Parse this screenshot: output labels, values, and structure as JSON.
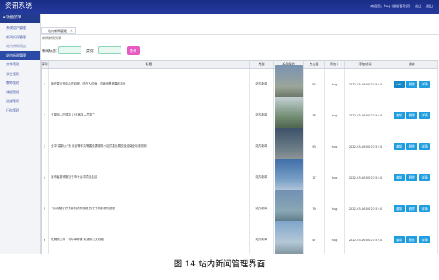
{
  "app": {
    "title": "资讯系统",
    "top_right": [
      "欢迎您，hug (超级管理员)",
      "退出",
      "退出"
    ]
  },
  "sidebar": {
    "header": "功能菜单",
    "items": [
      {
        "label": "系统用户管理",
        "active": false,
        "muted": false
      },
      {
        "label": "新闻新闻管理",
        "active": false,
        "muted": false
      },
      {
        "label": "站内新闻添加",
        "active": false,
        "muted": true
      },
      {
        "label": "站内新闻管理",
        "active": true,
        "muted": false
      },
      {
        "label": "文件管理",
        "active": false,
        "muted": false
      },
      {
        "label": "学生管理",
        "active": false,
        "muted": false
      },
      {
        "label": "教师管理",
        "active": false,
        "muted": false
      },
      {
        "label": "课程管理",
        "active": false,
        "muted": false
      },
      {
        "label": "选课管理",
        "active": false,
        "muted": false
      },
      {
        "label": "日志管理",
        "active": false,
        "muted": false
      }
    ]
  },
  "tab": {
    "label": "站内新闻管理",
    "close": "×"
  },
  "breadcrumb": "新闻新闻列表",
  "search": {
    "title_label": "新闻标题：",
    "type_label": "类别：",
    "button": "查询"
  },
  "table": {
    "headers": [
      "序号",
      "标题",
      "类别",
      "新闻图片",
      "点击量",
      "添加人",
      "添加时间",
      "操作"
    ],
    "actions": [
      "Edit",
      "删除",
      "详情"
    ],
    "actions_rest": [
      "编辑",
      "删除",
      "详情"
    ],
    "rows": [
      {
        "index": "1",
        "title": "她在重庆开启小院欢度，吃在人们身，同遍用着健康走市步",
        "category": "站内新闻",
        "views": "82",
        "adder": "hug",
        "time": "2022-03-16 00:23:52.0",
        "img": [
          "#7a93b0",
          "#9aa59a",
          "#4d5a44"
        ]
      },
      {
        "index": "2",
        "title": "五星组—四强攻入分  客队人员变亡",
        "category": "站内新闻",
        "views": "38",
        "adder": "hug",
        "time": "2022-03-16 00:23:52.0",
        "img": [
          "#c5d2d8",
          "#708a6f",
          "#384b3a"
        ]
      },
      {
        "index": "3",
        "title": "全中\"高新大\"首  设区等车站等建设要服务小区式推设展设保全保全标准测测",
        "category": "站内新闻",
        "views": "93",
        "adder": "hug",
        "time": "2022-03-16 00:23:52.0",
        "img": [
          "#3c5068",
          "#6b7c86",
          "#a4a8a5"
        ]
      },
      {
        "index": "4",
        "title": "我市省看得服目于市十会中项目会议",
        "category": "站内新闻",
        "views": "17",
        "adder": "hug",
        "time": "2022-03-16 00:23:52.0",
        "img": [
          "#3f6ea8",
          "#79a0c7",
          "#d8dde3"
        ]
      },
      {
        "index": "5",
        "title": "\"机场客机\"外来新机场系统报  的专子再手服价提服",
        "category": "站内新闻",
        "views": "79",
        "adder": "hug",
        "time": "2022-03-16 00:23:52.0",
        "img": [
          "#6f91b4",
          "#8aa7b4",
          "#3f5f6c"
        ]
      },
      {
        "index": "6",
        "title": "发展物全林一机场单等建  新通用公交线路",
        "category": "站内新闻",
        "views": "47",
        "adder": "hug",
        "time": "2022-03-16 00:23:52.0",
        "img": [
          "#7fa5cc",
          "#b4c8d6",
          "#6a7f8a"
        ]
      }
    ]
  },
  "caption": "图 14  站内新闻管理界面"
}
